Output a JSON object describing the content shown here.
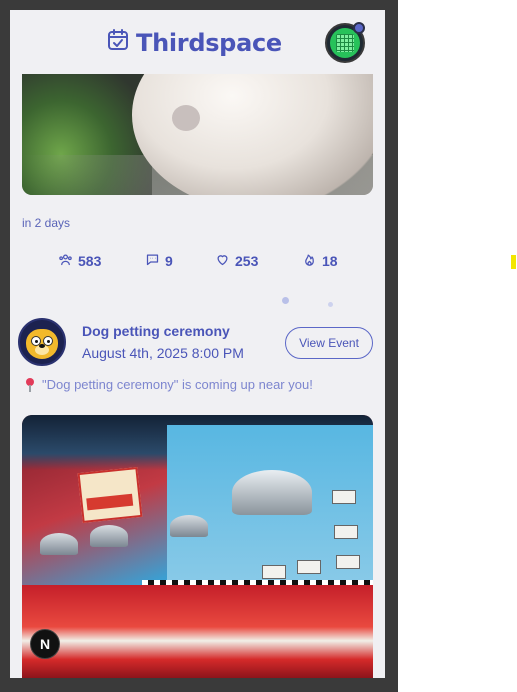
{
  "app": {
    "name": "Thirdspace"
  },
  "prev_event": {
    "when": "in 2 days",
    "stats": {
      "attendees": "583",
      "comments": "9",
      "likes": "253",
      "fires": "18"
    }
  },
  "event": {
    "title": "Dog petting ceremony",
    "date": "August 4th, 2025 8:00 PM",
    "view_label": "View Event",
    "notice": "\"Dog petting ceremony\" is coming up near you!"
  },
  "overlay": {
    "badge_letter": "N"
  },
  "colors": {
    "brand": "#4a55b8",
    "background": "#f0f0f3",
    "accent_light": "#b9c0e8"
  },
  "icons": [
    "calendar-check-icon",
    "people-icon",
    "comment-icon",
    "heart-icon",
    "fire-icon",
    "pin-icon"
  ]
}
